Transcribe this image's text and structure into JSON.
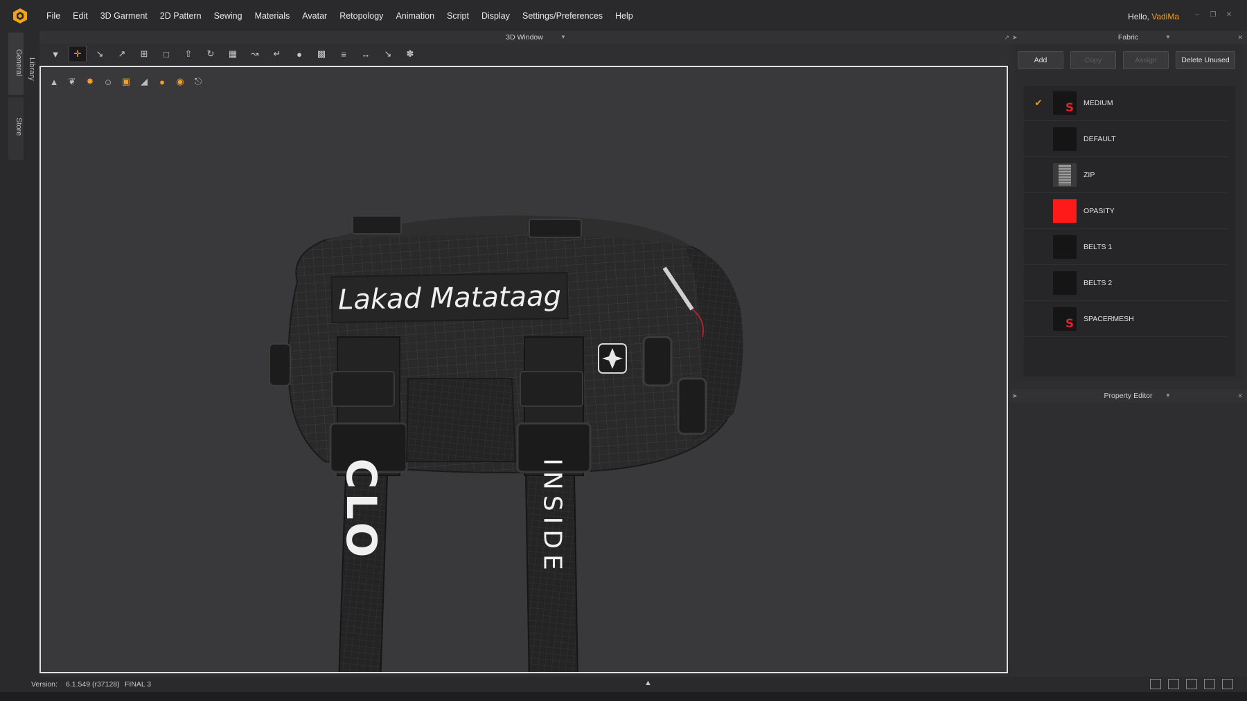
{
  "menu": {
    "items": [
      "File",
      "Edit",
      "3D Garment",
      "2D Pattern",
      "Sewing",
      "Materials",
      "Avatar",
      "Retopology",
      "Animation",
      "Script",
      "Display",
      "Settings/Preferences",
      "Help"
    ],
    "greeting_prefix": "Hello,",
    "user": "VadiMa"
  },
  "left_tabs": {
    "general": "General",
    "library": "Library",
    "store": "Store"
  },
  "window3d": {
    "title": "3D Window"
  },
  "viewport_text": {
    "banner": "Lakad Matataag",
    "strap_left": "CLO",
    "strap_right": "INSIDE"
  },
  "fabric_panel": {
    "title": "Fabric",
    "buttons": {
      "add": "Add",
      "copy": "Copy",
      "assign": "Assign",
      "delete_unused": "Delete Unused"
    },
    "items": [
      {
        "name": "MEDIUM",
        "selected": true,
        "swatch": "logo"
      },
      {
        "name": "DEFAULT",
        "selected": false,
        "swatch": "black"
      },
      {
        "name": "ZIP",
        "selected": false,
        "swatch": "zip"
      },
      {
        "name": "OPASITY",
        "selected": false,
        "swatch": "red"
      },
      {
        "name": "BELTS 1",
        "selected": false,
        "swatch": "black"
      },
      {
        "name": "BELTS 2",
        "selected": false,
        "swatch": "black"
      },
      {
        "name": "SPACERMESH",
        "selected": false,
        "swatch": "logo"
      }
    ]
  },
  "property_editor": {
    "title": "Property Editor"
  },
  "status": {
    "version_label": "Version:",
    "version": "6.1.549 (r37128)",
    "build": "FINAL 3"
  },
  "colors": {
    "accent": "#f2a31b",
    "red_swatch": "#ff1a1a"
  }
}
